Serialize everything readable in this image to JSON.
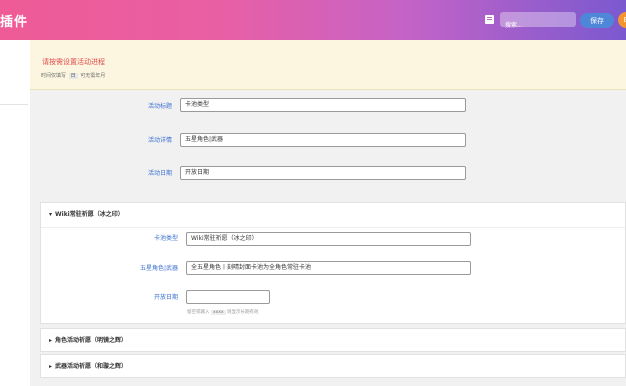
{
  "header": {
    "title": "插件",
    "search_placeholder": "搜索...",
    "save_label": "保存",
    "orange_icon": "B"
  },
  "notice": {
    "title": "请按需设置活动进程",
    "desc_before": "时间仅填写",
    "desc_code": "日",
    "desc_after": "可无需年月"
  },
  "activity": {
    "fields": [
      {
        "label": "活动标题",
        "value": "卡池类型"
      },
      {
        "label": "活动详情",
        "value": "五星角色|武器"
      },
      {
        "label": "活动日期",
        "value": "开放日期"
      }
    ]
  },
  "panels": [
    {
      "title": "Wiki常驻祈愿（冰之印）",
      "expanded": true,
      "fields": [
        {
          "label": "卡池类型",
          "value": "Wiki常驻祈愿（冰之印）"
        },
        {
          "label": "五星角色|武器",
          "value": "全五星角色丨刻晴封面卡池为全角色常驻卡池"
        },
        {
          "label": "开放日期",
          "value": ""
        }
      ],
      "hint_before": "留空或输入",
      "hint_code": "xxxx",
      "hint_after": "则显示长期有效"
    },
    {
      "title": "角色活动祈愿（明镜之辉）",
      "expanded": false
    },
    {
      "title": "武器活动祈愿（和璇之辉）",
      "expanded": false
    }
  ],
  "colors": {
    "label": "#3a6fd0",
    "notice_title": "#e04c4c",
    "save": "#4f87d8",
    "orange": "#f29531"
  }
}
